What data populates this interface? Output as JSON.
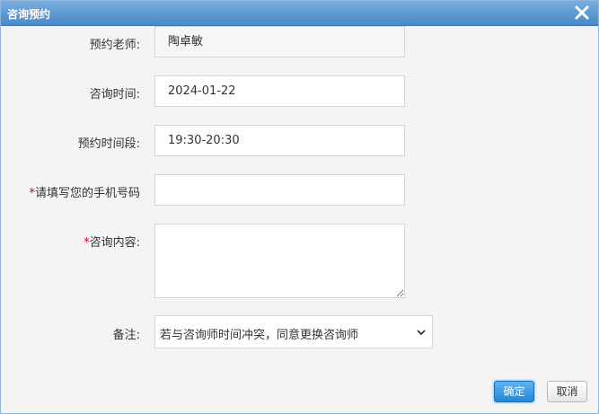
{
  "dialog": {
    "title": "咨询预约",
    "close_icon": "close-icon"
  },
  "form": {
    "teacher": {
      "label": "预约老师:",
      "value": "陶卓敏"
    },
    "date": {
      "label": "咨询时间:",
      "value": "2024-01-22"
    },
    "slot": {
      "label": "预约时间段:",
      "value": "19:30-20:30"
    },
    "phone": {
      "required_mark": "*",
      "label": "请填写您的手机号码",
      "value": ""
    },
    "content": {
      "required_mark": "*",
      "label": "咨询内容:",
      "value": ""
    },
    "note": {
      "label": "备注:",
      "selected": "若与咨询师时间冲突，同意更换咨询师"
    }
  },
  "buttons": {
    "ok_label": "确定",
    "cancel_label": "取消"
  },
  "colors": {
    "title_bar": "#4a88c8",
    "required": "#d0021b",
    "primary_button": "#1f89d8"
  }
}
